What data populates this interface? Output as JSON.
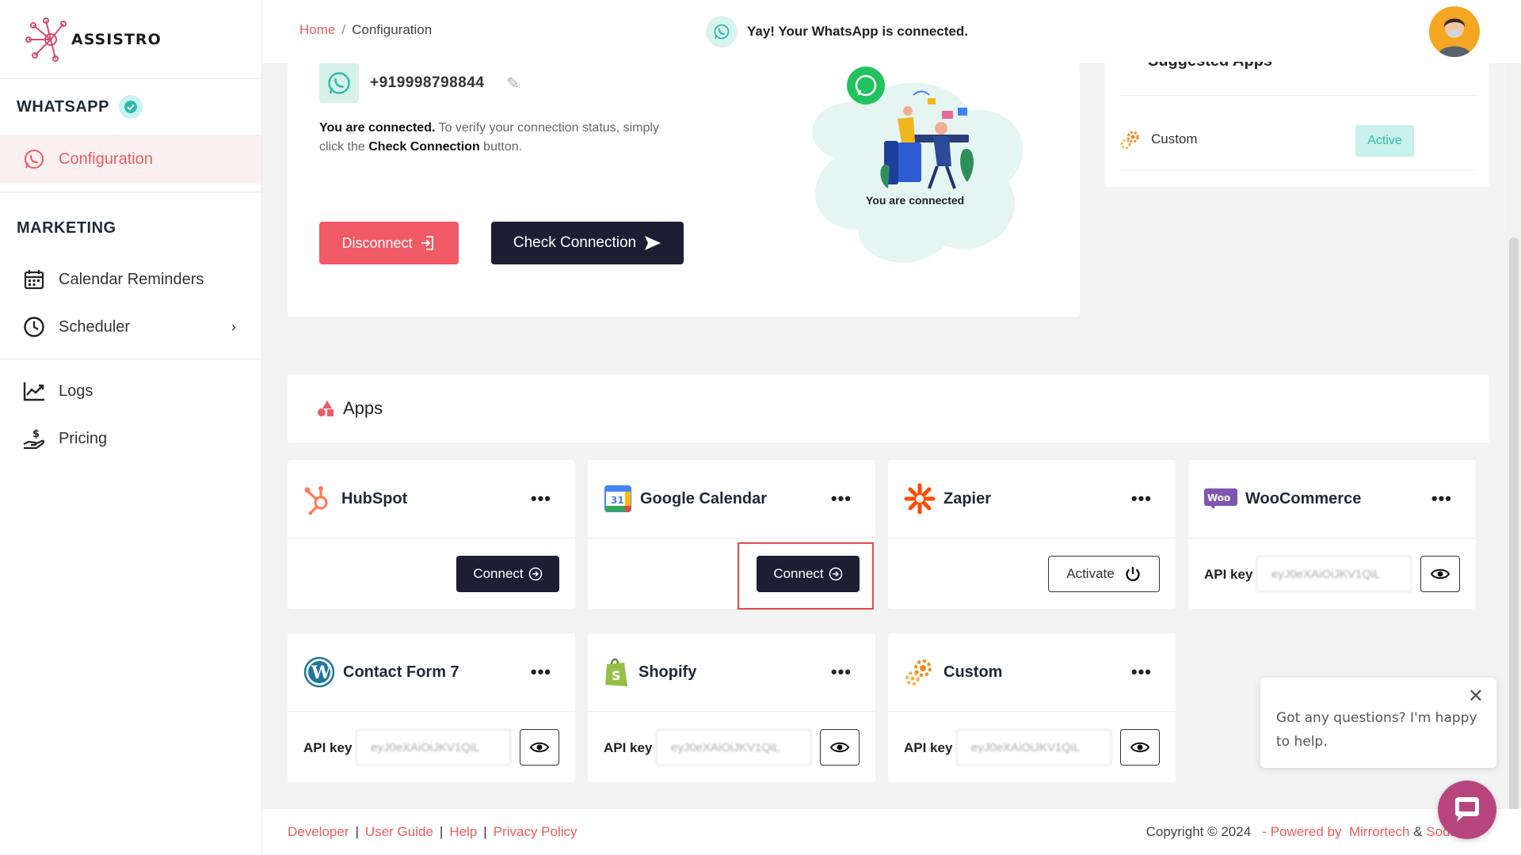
{
  "brand": {
    "name": "ASSISTRO",
    "accent": "#ee5b62",
    "dark": "#1c1f33",
    "teal": "#2bbbab"
  },
  "sidebar": {
    "section_whatsapp": "WHATSAPP",
    "section_marketing": "MARKETING",
    "items": [
      {
        "label": "Configuration",
        "icon": "whatsapp-icon",
        "active": true
      },
      {
        "label": "Calendar Reminders",
        "icon": "calendar-icon"
      },
      {
        "label": "Scheduler",
        "icon": "clock-icon"
      },
      {
        "label": "Logs",
        "icon": "chart-line-icon"
      },
      {
        "label": "Pricing",
        "icon": "hand-dollar-icon"
      }
    ]
  },
  "header": {
    "breadcrumb_home": "Home",
    "breadcrumb_sep": "/",
    "breadcrumb_current": "Configuration",
    "status_message": "Yay! Your WhatsApp is connected."
  },
  "connection": {
    "phone": "+919998798844",
    "text_bold": "You are connected.",
    "text_rest": " To verify your connection status, simply click the ",
    "text_bold2": "Check Connection",
    "text_end": " button.",
    "disconnect_label": "Disconnect",
    "check_label": "Check Connection",
    "illustration_caption": "You are connected"
  },
  "suggested": {
    "title": "Suggested Apps",
    "item_name": "Custom",
    "item_status": "Active"
  },
  "apps": {
    "title": "Apps",
    "list": [
      {
        "name": "HubSpot",
        "action": "Connect"
      },
      {
        "name": "Google Calendar",
        "action": "Connect"
      },
      {
        "name": "Zapier",
        "action": "Activate"
      },
      {
        "name": "WooCommerce",
        "api_label": "API key",
        "api_value": "eyJ0eXAiOiJKV1QiL"
      },
      {
        "name": "Contact Form 7",
        "api_label": "API key",
        "api_value": "eyJ0eXAiOiJKV1QiL"
      },
      {
        "name": "Shopify",
        "api_label": "API key",
        "api_value": "eyJ0eXAiOiJKV1QiL"
      },
      {
        "name": "Custom",
        "api_label": "API key",
        "api_value": "eyJ0eXAiOiJKV1QiL"
      }
    ],
    "more_label": "•••"
  },
  "footer": {
    "links": [
      "Developer",
      "User Guide",
      "Help",
      "Privacy Policy"
    ],
    "copyright": "Copyright © 2024",
    "powered": "- Powered by",
    "company1": "Mirrortech",
    "amp": "&",
    "company2": "Soda"
  },
  "chat": {
    "message": "Got any questions? I'm happy to help.",
    "close": "✕"
  }
}
